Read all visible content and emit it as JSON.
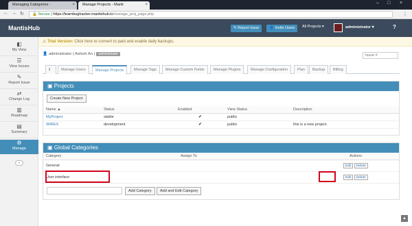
{
  "browser": {
    "tab1_title": "Managing Categories -",
    "tab2_title": "Manage Projects - Manti",
    "secure_label": "Secure",
    "url_host": "https://learnbugtracker.mantishub.io",
    "url_path": "/manage_proj_page.php"
  },
  "app": {
    "brand": "MantisHub",
    "report_issue": "Report Issue",
    "invite_users": "Invite Users",
    "project_select": "All Projects",
    "user": "administrator",
    "help": "?"
  },
  "sidebar": {
    "items": [
      {
        "label": "My View",
        "icon": "dashboard-icon"
      },
      {
        "label": "View Issues",
        "icon": "list-icon"
      },
      {
        "label": "Report Issue",
        "icon": "pencil-icon"
      },
      {
        "label": "Change Log",
        "icon": "retweet-icon"
      },
      {
        "label": "Roadmap",
        "icon": "road-icon"
      },
      {
        "label": "Summary",
        "icon": "bar-chart-icon"
      },
      {
        "label": "Manage",
        "icon": "gears-icon"
      }
    ]
  },
  "trial": {
    "bold": "Trial Version:",
    "text": " Click here to convert to paid and enable daily backups."
  },
  "userbar": {
    "name": "administrator ( Ashish An )",
    "badge": "administrator"
  },
  "search": {
    "placeholder": "Issue #"
  },
  "tabs": [
    "Manage Users",
    "Manage Projects",
    "Manage Tags",
    "Manage Custom Fields",
    "Manage Plugins",
    "Manage Configuration",
    "Plan",
    "Backup",
    "Billing"
  ],
  "projects": {
    "title": "Projects",
    "create_button": "Create New Project",
    "columns": [
      "Name ▲",
      "Status",
      "Enabled",
      "View Status",
      "Description"
    ],
    "rows": [
      {
        "name": "MyProject",
        "status": "stable",
        "enabled": "✔",
        "view_status": "public",
        "description": ""
      },
      {
        "name": "WIRES",
        "status": "development",
        "enabled": "✔",
        "view_status": "public",
        "description": "this is a new project."
      }
    ]
  },
  "categories": {
    "title": "Global Categories",
    "columns": [
      "Category",
      "Assign To",
      "Actions"
    ],
    "rows": [
      {
        "category": "General",
        "assign_to": "",
        "edit": "Edit",
        "delete": "Delete"
      },
      {
        "category": "User interface",
        "assign_to": "",
        "edit": "Edit",
        "delete": "Delete"
      }
    ],
    "add_category": "Add Category",
    "add_edit_category": "Add and Edit Category"
  },
  "colors": {
    "navbar": "#3b4a5c",
    "accent": "#438eb9",
    "highlight": "#d0021b"
  }
}
